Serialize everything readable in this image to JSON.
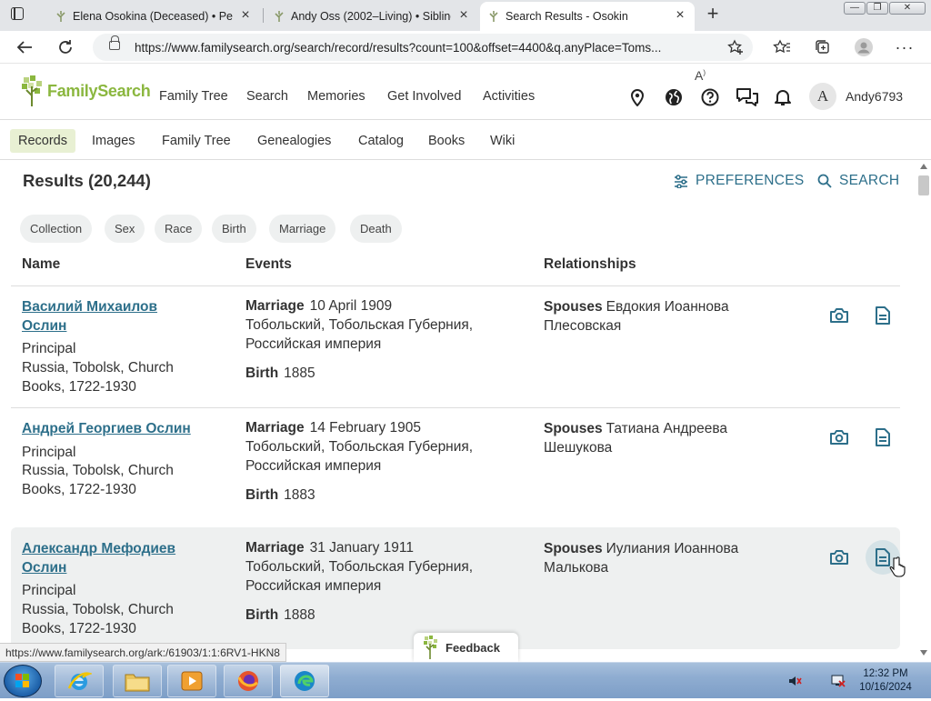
{
  "browser": {
    "tabs": [
      {
        "title": "Elena Osokina (Deceased) • Perso",
        "active": false
      },
      {
        "title": "Andy Oss (2002–Living) • Sibling",
        "active": false
      },
      {
        "title": "Search Results - Osokin",
        "active": true
      }
    ],
    "url": "https://www.familysearch.org/search/record/results?count=100&offset=4400&q.anyPlace=Toms..."
  },
  "header": {
    "brand": "FamilySearch",
    "nav": [
      "Family Tree",
      "Search",
      "Memories",
      "Get Involved",
      "Activities"
    ],
    "avatar_letter": "A",
    "username": "Andy6793"
  },
  "subnav": {
    "items": [
      "Records",
      "Images",
      "Family Tree",
      "Genealogies",
      "Catalog",
      "Books",
      "Wiki"
    ],
    "active": "Records"
  },
  "results": {
    "title": "Results (20,244)",
    "preferences_label": "PREFERENCES",
    "search_label": "SEARCH",
    "filters": [
      "Collection",
      "Sex",
      "Race",
      "Birth",
      "Marriage",
      "Death"
    ],
    "columns": {
      "name": "Name",
      "events": "Events",
      "relationships": "Relationships"
    },
    "rows": [
      {
        "name": "Василий Михаилов Ослин",
        "role": "Principal",
        "collection": "Russia, Tobolsk, Church Books, 1722-1930",
        "marriage_label": "Marriage",
        "marriage_date": "10 April 1909",
        "marriage_place": "Тобольский, Тобольская Губерния, Российская империя",
        "birth_label": "Birth",
        "birth_year": "1885",
        "spouses_label": "Spouses",
        "spouse": "Евдокия Иоаннова Плесовская"
      },
      {
        "name": "Андрей Георгиев Ослин",
        "role": "Principal",
        "collection": "Russia, Tobolsk, Church Books, 1722-1930",
        "marriage_label": "Marriage",
        "marriage_date": "14 February 1905",
        "marriage_place": "Тобольский, Тобольская Губерния, Российская империя",
        "birth_label": "Birth",
        "birth_year": "1883",
        "spouses_label": "Spouses",
        "spouse": "Татиана Андреева Шешукова"
      },
      {
        "name": "Александр Мефодиев Ослин",
        "role": "Principal",
        "collection": "Russia, Tobolsk, Church Books, 1722-1930",
        "marriage_label": "Marriage",
        "marriage_date": "31 January 1911",
        "marriage_place": "Тобольский, Тобольская Губерния, Российская империя",
        "birth_label": "Birth",
        "birth_year": "1888",
        "spouses_label": "Spouses",
        "spouse": "Иулиания Иоаннова Малькова"
      }
    ]
  },
  "status_url": "https://www.familysearch.org/ark:/61903/1:1:6RV1-HKN8",
  "feedback_label": "Feedback",
  "taskbar": {
    "time": "12:32 PM",
    "date": "10/16/2024"
  },
  "colors": {
    "link": "#2d6f8a",
    "brand_green": "#8bb73f",
    "active_subnav": "#e8f0d3",
    "hover_row": "#eef0f0"
  }
}
